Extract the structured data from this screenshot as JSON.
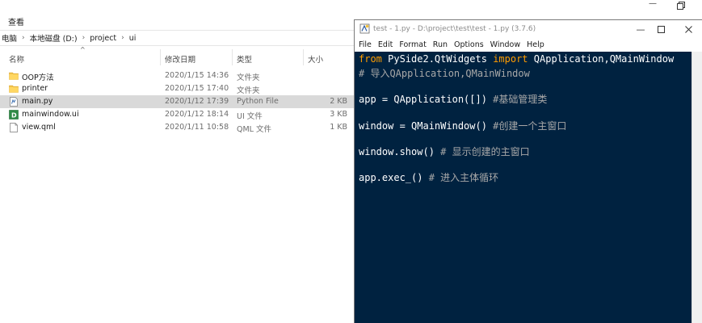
{
  "explorer": {
    "menu_view": "查看",
    "breadcrumb": [
      "电脑",
      "本地磁盘 (D:)",
      "project",
      "ui"
    ],
    "columns": {
      "name": "名称",
      "date": "修改日期",
      "type": "类型",
      "size": "大小"
    },
    "files": [
      {
        "name": "OOP方法",
        "date": "2020/1/15 14:36",
        "type": "文件夹",
        "size": "",
        "icon": "folder-icon"
      },
      {
        "name": "printer",
        "date": "2020/1/15 17:40",
        "type": "文件夹",
        "size": "",
        "icon": "folder-icon"
      },
      {
        "name": "main.py",
        "date": "2020/1/12 17:39",
        "type": "Python File",
        "size": "2 KB",
        "icon": "python-file-icon"
      },
      {
        "name": "mainwindow.ui",
        "date": "2020/1/12 18:14",
        "type": "UI 文件",
        "size": "3 KB",
        "icon": "ui-file-icon"
      },
      {
        "name": "view.qml",
        "date": "2020/1/11 10:58",
        "type": "QML 文件",
        "size": "1 KB",
        "icon": "document-icon"
      }
    ],
    "selected_index": 2
  },
  "idle": {
    "title": "test - 1.py - D:\\project\\test\\test - 1.py (3.7.6)",
    "menu": [
      "File",
      "Edit",
      "Format",
      "Run",
      "Options",
      "Window",
      "Help"
    ],
    "code": {
      "l1_kw1": "from",
      "l1_mod": " PySide2.QtWidgets ",
      "l1_kw2": "import",
      "l1_rest": " QApplication,QMainWindow",
      "l2_comment": "# 导入QApplication,QMainWindow",
      "l3_code": "app = QApplication([]) ",
      "l3_comment": "#基础管理类",
      "l4_code": "window = QMainWindow() ",
      "l4_comment": "#创建一个主窗口",
      "l5_code": "window.show() ",
      "l5_comment": "# 显示创建的主窗口",
      "l6_code": "app.exec_() ",
      "l6_comment": "# 进入主体循环"
    },
    "colors": {
      "editor_bg": "#002240",
      "keyword": "#ff9d00",
      "comment": "#a8a8a8",
      "text": "#ffffff"
    }
  }
}
